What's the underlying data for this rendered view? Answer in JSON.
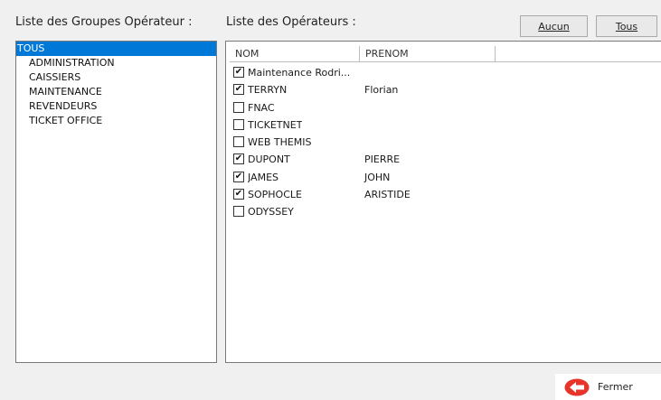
{
  "labels": {
    "groups": "Liste des Groupes Opérateur :",
    "operators": "Liste des Opérateurs :"
  },
  "buttons": {
    "aucun": "Aucun",
    "tous": "Tous",
    "fermer": "Fermer"
  },
  "groups": [
    {
      "label": "TOUS",
      "selected": true
    },
    {
      "label": "ADMINISTRATION",
      "selected": false
    },
    {
      "label": "CAISSIERS",
      "selected": false
    },
    {
      "label": "MAINTENANCE",
      "selected": false
    },
    {
      "label": "REVENDEURS",
      "selected": false
    },
    {
      "label": "TICKET OFFICE",
      "selected": false
    }
  ],
  "table": {
    "headers": {
      "nom": "NOM",
      "prenom": "PRENOM"
    },
    "rows": [
      {
        "nom": "Maintenance Rodri...",
        "prenom": "",
        "checked": true
      },
      {
        "nom": "TERRYN",
        "prenom": "Florian",
        "checked": true
      },
      {
        "nom": "FNAC",
        "prenom": "",
        "checked": false
      },
      {
        "nom": "TICKETNET",
        "prenom": "",
        "checked": false
      },
      {
        "nom": "WEB THEMIS",
        "prenom": "",
        "checked": false
      },
      {
        "nom": "DUPONT",
        "prenom": "PIERRE",
        "checked": true
      },
      {
        "nom": "JAMES",
        "prenom": "JOHN",
        "checked": true
      },
      {
        "nom": "SOPHOCLE",
        "prenom": "ARISTIDE",
        "checked": true
      },
      {
        "nom": "ODYSSEY",
        "prenom": "",
        "checked": false
      }
    ]
  },
  "colors": {
    "selection": "#0078d7",
    "fermer_icon": "#e8352a"
  },
  "icons": {
    "fermer": "back-arrow-icon"
  }
}
